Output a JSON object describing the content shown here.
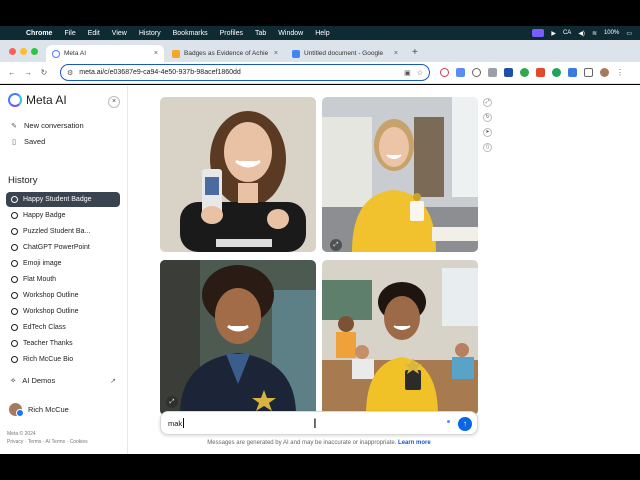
{
  "menubar": {
    "apple": "",
    "items": [
      "Chrome",
      "File",
      "Edit",
      "View",
      "History",
      "Bookmarks",
      "Profiles",
      "Tab",
      "Window",
      "Help"
    ],
    "status": [
      "CA",
      "100%"
    ]
  },
  "tabs": [
    {
      "label": "Meta AI",
      "color": "#4a7bff",
      "active": true
    },
    {
      "label": "Badges as Evidence of Achie",
      "color": "#f6a623",
      "active": false
    },
    {
      "label": "Untitled document - Google",
      "color": "#4285f4",
      "active": false
    }
  ],
  "address": {
    "url": "meta.ai/c/e03687e9-ca94-4e50-937b-98acef1860dd"
  },
  "sidebar": {
    "brand": "Meta AI",
    "new_conversation": "New conversation",
    "saved": "Saved",
    "history_heading": "History",
    "history": [
      "Happy Student Badge",
      "Happy Badge",
      "Puzzled Student Ba...",
      "ChatGPT PowerPoint",
      "Emoji image",
      "Flat Mouth",
      "Workshop Outline",
      "Workshop Outline",
      "EdTech Class",
      "Teacher Thanks",
      "Rich McCue Bio"
    ],
    "demos": "AI Demos",
    "user": "Rich McCue",
    "copyright": "Meta © 2024",
    "footer_links": "Privacy · Terms · AI Terms · Cookies"
  },
  "prompt": {
    "value": "mak"
  },
  "disclaimer": {
    "text": "Messages are generated by AI and may be inaccurate or inappropriate.",
    "link": "Learn more"
  },
  "colors": {
    "accent": "#0a66e4",
    "selected_history": "#3a4450"
  }
}
